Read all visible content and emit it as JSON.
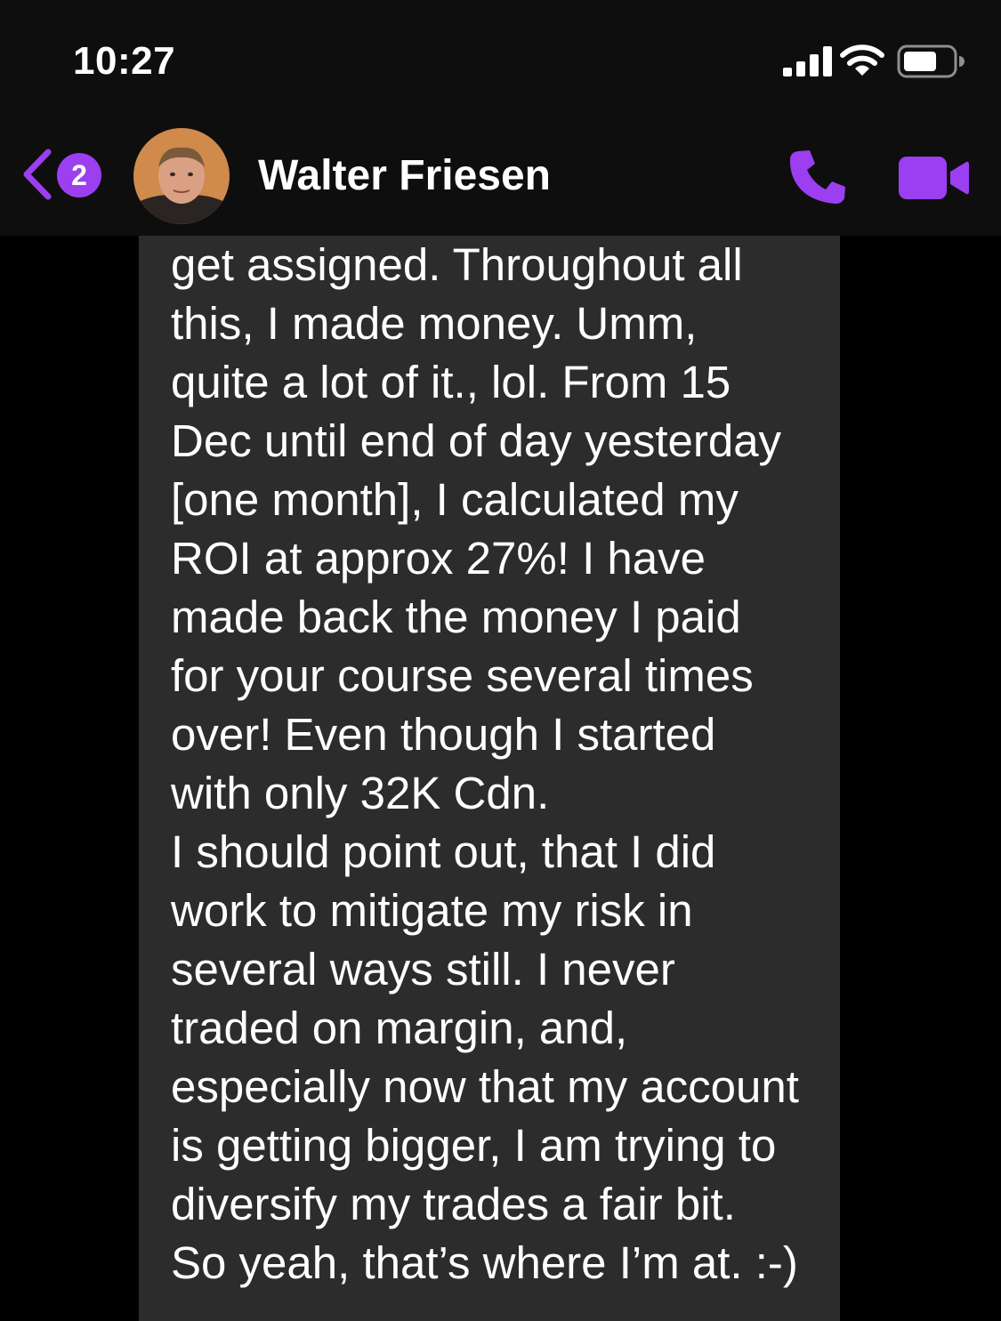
{
  "status_bar": {
    "time": "10:27",
    "icons": [
      "cellular-signal-icon",
      "wifi-icon",
      "battery-icon"
    ]
  },
  "header": {
    "back_icon": "chevron-left-icon",
    "unread_count": "2",
    "contact_name": "Walter Friesen",
    "call_icon": "phone-icon",
    "video_icon": "video-camera-icon",
    "accent_color": "#9b3ff0"
  },
  "message": {
    "text": "get assigned. Throughout all\nthis, I made money. Umm,\nquite a lot of it., lol. From 15\nDec until end of day yesterday\n[one month], I calculated my\nROI at approx 27%! I have\nmade back the money I paid\nfor your course several times\nover! Even though I started\nwith only 32K Cdn.\nI should point out, that I did\nwork to mitigate my risk in\nseveral ways still. I never\ntraded on margin, and,\nespecially now that my account\nis getting bigger, I am trying to\ndiversify my trades a fair bit.\nSo yeah, that’s where I’m at. :-)",
    "bubble_color": "#2c2c2d"
  }
}
